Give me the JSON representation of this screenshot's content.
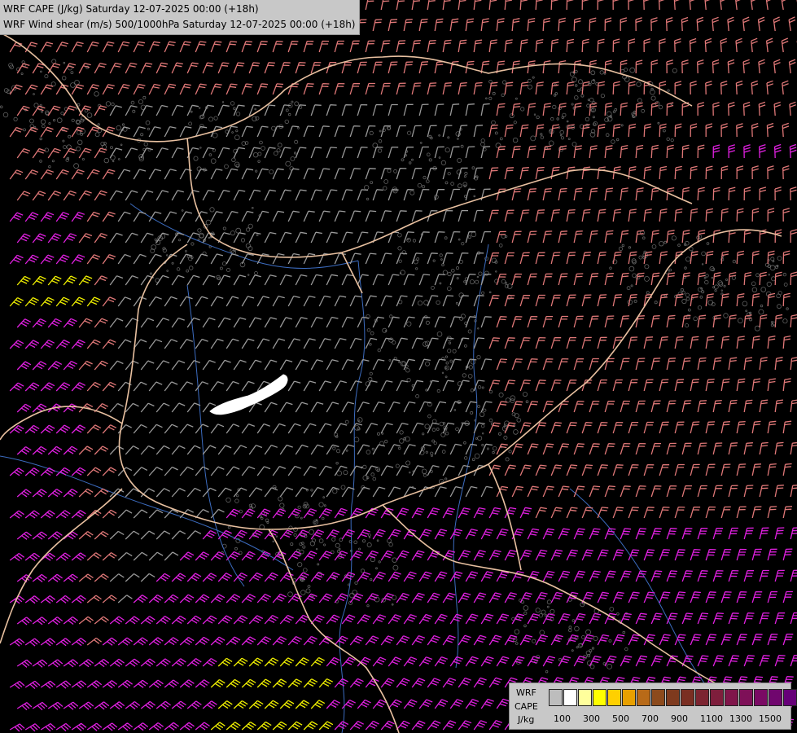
{
  "title": {
    "line1": "WRF CAPE (J/kg) Saturday 12-07-2025 00:00 (+18h)",
    "line2": "WRF Wind shear (m/s) 500/1000hPa Saturday 12-07-2025 00:00 (+18h)"
  },
  "legend": {
    "label_wrf": "WRF",
    "label_cape": "CAPE",
    "label_unit": "J/kg",
    "ticks": [
      "100",
      "300",
      "500",
      "700",
      "900",
      "1100",
      "1300",
      "1500"
    ],
    "colors": [
      "#bdbdbd",
      "#ffffff",
      "#ffff9c",
      "#ffff00",
      "#ffd000",
      "#e8a000",
      "#b86a18",
      "#8c4a1c",
      "#7e3a1e",
      "#7a2e22",
      "#7c2430",
      "#7e1e3c",
      "#80164a",
      "#7e1058",
      "#7a0a64",
      "#70066e",
      "#660078"
    ]
  },
  "colors": {
    "background": "#000000",
    "border": "#e8c0a0",
    "river": "#3c6cc0",
    "barb_gray": "#9a9a9a",
    "barb_pink": "#e07878",
    "barb_magenta": "#e020e0",
    "barb_yellow": "#f0f000"
  }
}
